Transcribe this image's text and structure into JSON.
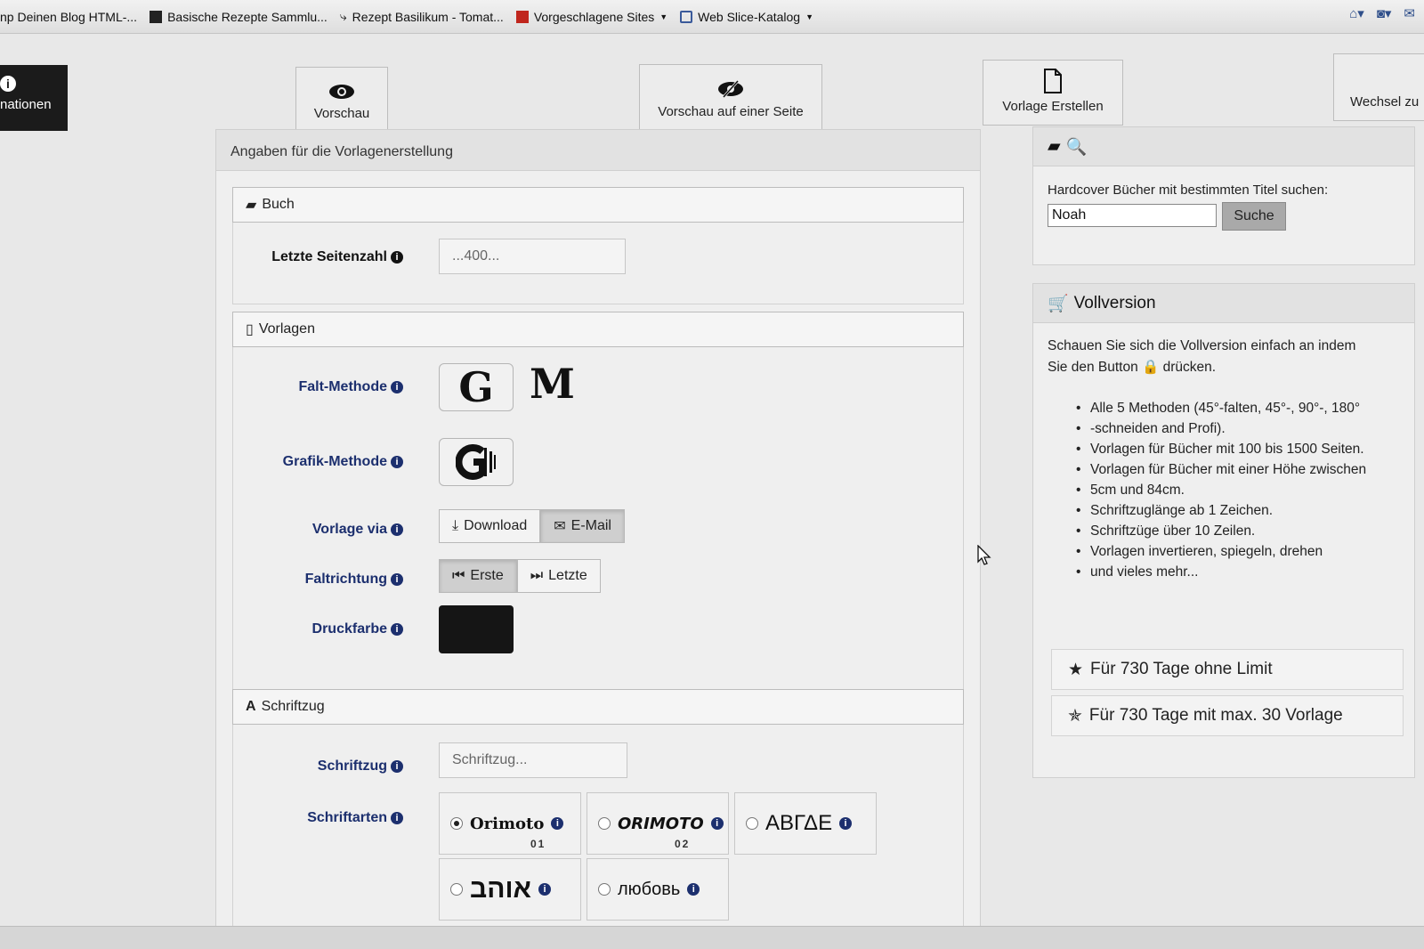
{
  "bookmarks": [
    {
      "label": "np Deinen Blog HTML-...",
      "icon": "none"
    },
    {
      "label": "Basische Rezepte Sammlu...",
      "icon": "dark-square"
    },
    {
      "label": "Rezept Basilikum - Tomat...",
      "icon": "link"
    },
    {
      "label": "Vorgeschlagene Sites",
      "icon": "red-square",
      "dropdown": true
    },
    {
      "label": "Web Slice-Katalog",
      "icon": "ie-slice",
      "dropdown": true
    }
  ],
  "side_tab": {
    "label": "nationen"
  },
  "nav": {
    "preview": "Vorschau",
    "preview_one_page": "Vorschau auf einer Seite",
    "create_template": "Vorlage Erstellen",
    "switch": "Wechsel zu"
  },
  "main": {
    "title": "Angaben für die Vorlagenerstellung",
    "book": {
      "section_title": "Buch",
      "last_page_label": "Letzte Seitenzahl",
      "last_page_placeholder": "...400..."
    },
    "templates": {
      "section_title": "Vorlagen",
      "fold_method_label": "Falt-Methode",
      "fold_method_options": [
        "G",
        "M"
      ],
      "graphic_method_label": "Grafik-Methode",
      "delivery_label": "Vorlage via",
      "delivery_options": [
        "Download",
        "E-Mail"
      ],
      "delivery_selected": "E-Mail",
      "fold_direction_label": "Faltrichtung",
      "fold_direction_options": [
        "Erste",
        "Letzte"
      ],
      "fold_direction_selected": "Erste",
      "print_color_label": "Druckfarbe",
      "print_color": "#151515"
    },
    "lettering": {
      "section_title": "Schriftzug",
      "lettering_label": "Schriftzug",
      "lettering_placeholder": "Schriftzug...",
      "fonts_label": "Schriftarten",
      "fonts": [
        {
          "name": "Orimoto",
          "number": "01",
          "selected": true
        },
        {
          "name": "ORIMOTO",
          "number": "02",
          "selected": false
        },
        {
          "name": "ΑΒΓΔΕ",
          "number": "",
          "selected": false
        },
        {
          "name": "אוהב",
          "number": "",
          "selected": false
        },
        {
          "name": "любовь",
          "number": "",
          "selected": false
        }
      ]
    }
  },
  "search": {
    "label": "Hardcover Bücher mit bestimmten Titel suchen:",
    "value": "Noah",
    "button": "Suche"
  },
  "full_version": {
    "title": "Vollversion",
    "intro_1": "Schauen Sie sich die Vollversion einfach an indem",
    "intro_2a": "Sie den Button",
    "intro_2b": "drücken.",
    "features": [
      "Alle 5 Methoden (45°-falten, 45°-, 90°-, 180°",
      "-schneiden and Profi).",
      "Vorlagen für Bücher mit 100 bis 1500 Seiten.",
      "Vorlagen für Bücher mit einer Höhe zwischen",
      "5cm und 84cm.",
      "Schriftzuglänge ab 1 Zeichen.",
      "Schriftzüge über 10 Zeilen.",
      "Vorlagen invertieren, spiegeln, drehen",
      "und vieles mehr..."
    ],
    "offer_1": "Für 730 Tage ohne Limit",
    "offer_2": "Für 730 Tage mit max. 30 Vorlage"
  }
}
